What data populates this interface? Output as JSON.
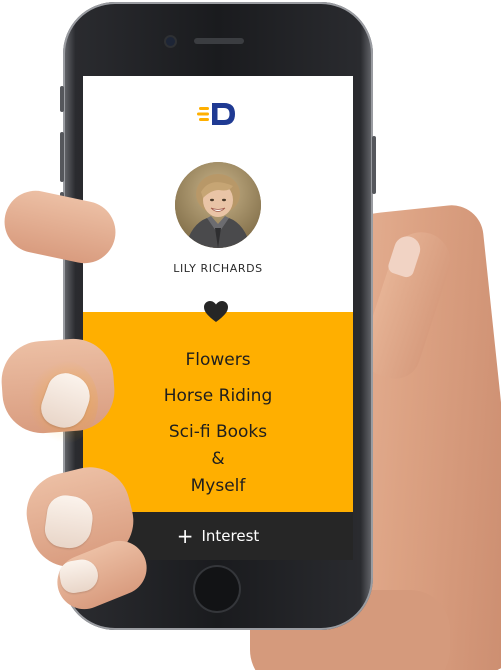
{
  "app": {
    "logo_icon": "d-logo-icon",
    "brand_color": "#ffaf00",
    "logo_color": "#1f3a93"
  },
  "profile": {
    "name": "LILY RICHARDS",
    "avatar_icon": "profile-photo"
  },
  "interests": {
    "heart_icon": "heart-icon",
    "items": [
      "Flowers",
      "Horse Riding",
      "Sci-fi Books",
      "&",
      "Myself"
    ],
    "background": "#ffaf00"
  },
  "add_button": {
    "icon": "plus-icon",
    "label": "Interest"
  }
}
